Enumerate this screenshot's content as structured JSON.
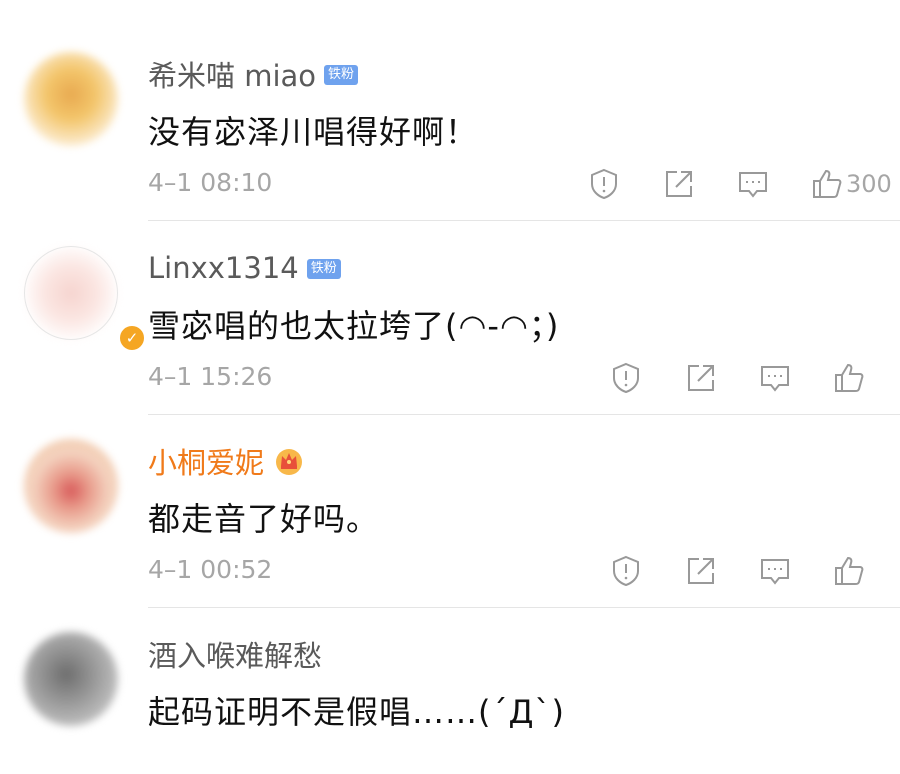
{
  "comments": [
    {
      "username": "希米喵 miao",
      "badge": "铁粉",
      "text": "没有宓泽川唱得好啊！",
      "time": "4–1 08:10",
      "likes": "300",
      "avatar_colors": [
        "#f3c56a",
        "#e8a950",
        "#fbe9c9"
      ]
    },
    {
      "username": "Linxx1314",
      "badge": "铁粉",
      "text": "雪宓唱的也太拉垮了(◠-◠；)",
      "time": "4–1 15:26",
      "likes": "",
      "avatar_colors": [
        "#fbe6e2",
        "#f6d4cf",
        "#ffffff"
      ]
    },
    {
      "username": "小桐爱妮",
      "badge": "",
      "text": "都走音了好吗。",
      "time": "4–1 00:52",
      "likes": "",
      "avatar_colors": [
        "#f4d3c0",
        "#d85a5a",
        "#f0c49a"
      ]
    },
    {
      "username": "酒入喉难解愁",
      "badge": "",
      "text": "起码证明不是假唱……(´Д`)",
      "time": "",
      "likes": "",
      "avatar_colors": [
        "#9a9a9a",
        "#6d6d6d",
        "#c9c9c9"
      ]
    }
  ],
  "icons": {
    "report": "shield-exclamation-icon",
    "share": "share-icon",
    "reply": "comment-icon",
    "like": "thumbs-up-icon",
    "crown": "crown-badge-icon"
  },
  "colors": {
    "username": "#5a5a5a",
    "vip_username": "#f07a1a",
    "fan_badge": "#6fa2ee",
    "meta": "#a6a6a6",
    "text": "#111111"
  }
}
